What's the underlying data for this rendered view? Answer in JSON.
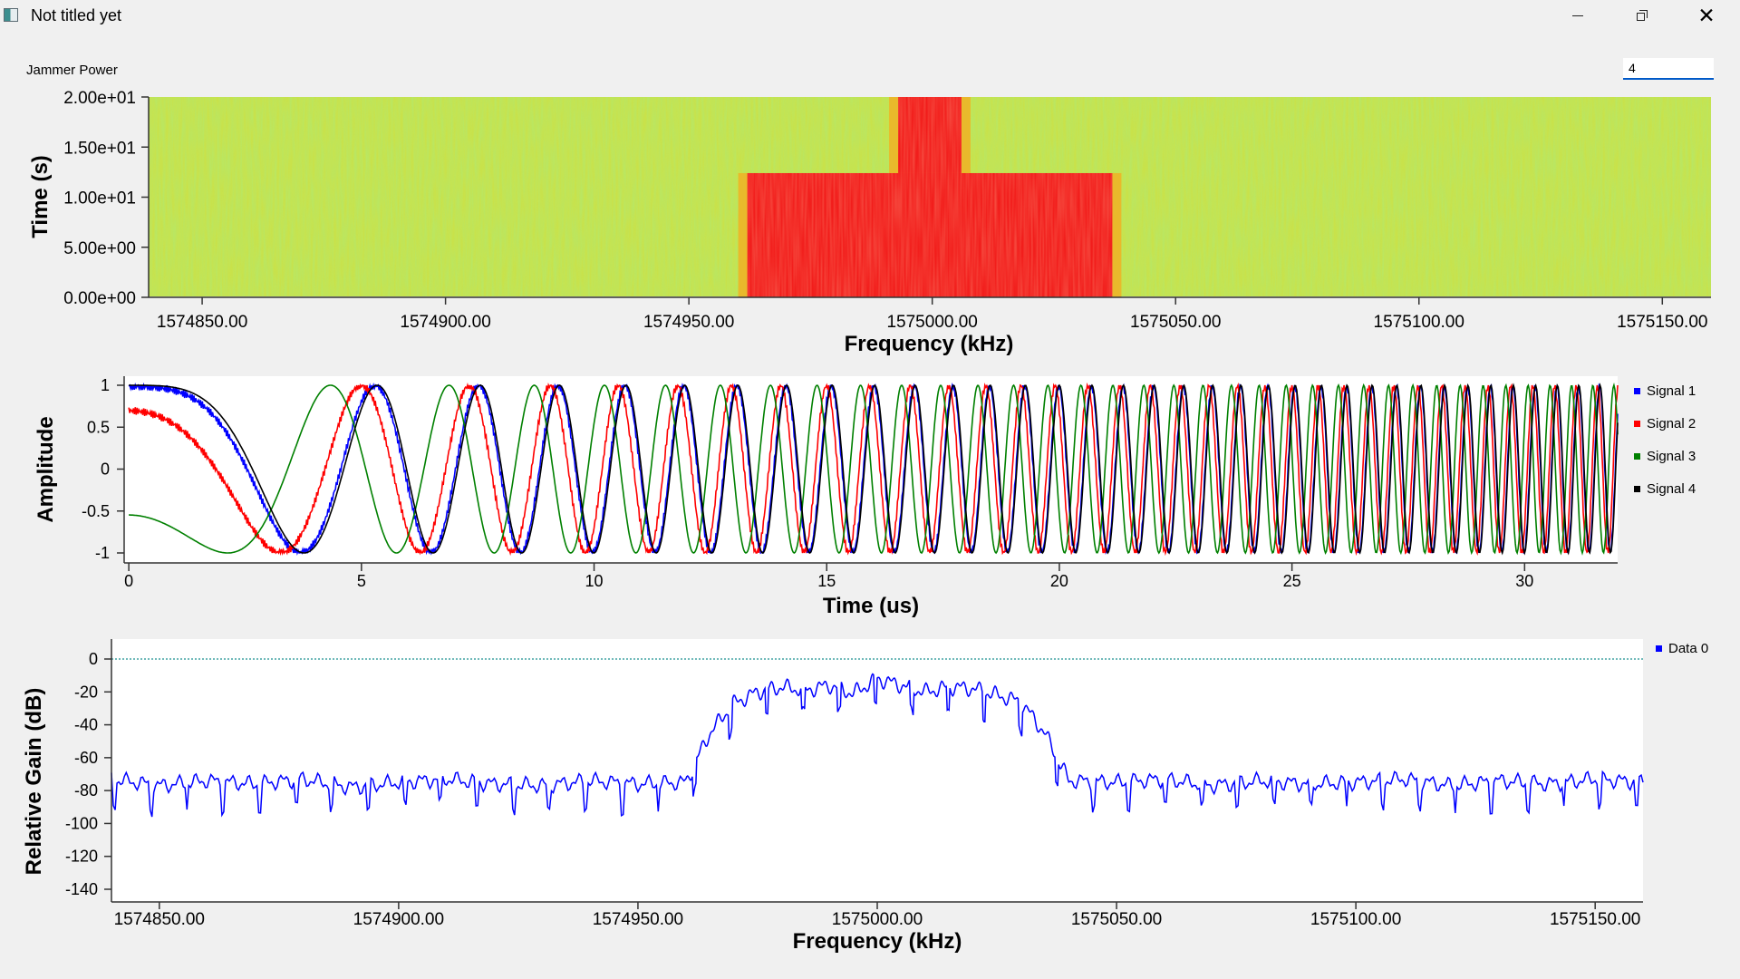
{
  "window": {
    "title": "Not titled yet",
    "controls": {
      "minimize": "minimize-icon",
      "maximize": "restore-icon",
      "close": "close-icon"
    }
  },
  "jammer_power": {
    "label": "Jammer Power",
    "value": "4"
  },
  "chart_data": [
    {
      "type": "heatmap",
      "xlabel": "Frequency (kHz)",
      "ylabel": "Time (s)",
      "x_ticks": [
        "1574850.00",
        "1574900.00",
        "1574950.00",
        "1575000.00",
        "1575050.00",
        "1575100.00",
        "1575150.00"
      ],
      "y_ticks": [
        "0.00e+00",
        "5.00e+00",
        "1.00e+01",
        "1.50e+01",
        "2.00e+01"
      ],
      "xlim": [
        1574839,
        1575160
      ],
      "ylim": [
        0,
        20
      ],
      "background": "noise floor",
      "features": [
        {
          "x": [
            1574962,
            1575037
          ],
          "y": [
            0,
            12.4
          ],
          "level": "high"
        },
        {
          "x": [
            1574993,
            1575006
          ],
          "y": [
            12.4,
            20
          ],
          "level": "high"
        }
      ]
    },
    {
      "type": "line",
      "xlabel": "Time (us)",
      "ylabel": "Amplitude",
      "x_ticks": [
        "0",
        "5",
        "10",
        "15",
        "20",
        "25",
        "30"
      ],
      "y_ticks": [
        "1",
        "0.5",
        "0",
        "-0.5",
        "-1"
      ],
      "xlim": [
        -0.1,
        32
      ],
      "ylim": [
        -1,
        1
      ],
      "legend": "right",
      "series": [
        {
          "name": "Signal 1",
          "color": "#0000ff"
        },
        {
          "name": "Signal 2",
          "color": "#ff0000"
        },
        {
          "name": "Signal 3",
          "color": "#008000"
        },
        {
          "name": "Signal 4",
          "color": "#000000"
        }
      ]
    },
    {
      "type": "line",
      "xlabel": "Frequency (kHz)",
      "ylabel": "Relative Gain (dB)",
      "x_ticks": [
        "1574850.00",
        "1574900.00",
        "1574950.00",
        "1575000.00",
        "1575050.00",
        "1575100.00",
        "1575150.00"
      ],
      "y_ticks": [
        "0",
        "-20",
        "-40",
        "-60",
        "-80",
        "-100",
        "-120",
        "-140"
      ],
      "xlim": [
        1574840,
        1575160
      ],
      "ylim": [
        -140,
        0
      ],
      "reference_line": 0,
      "legend": "right",
      "series": [
        {
          "name": "Data 0",
          "color": "#0000ff",
          "x": [
            1574840,
            1574850,
            1574860,
            1574870,
            1574880,
            1574890,
            1574900,
            1574910,
            1574920,
            1574930,
            1574940,
            1574950,
            1574960,
            1574965,
            1574970,
            1574975,
            1574980,
            1574985,
            1574990,
            1574995,
            1575000,
            1575005,
            1575010,
            1575015,
            1575020,
            1575025,
            1575030,
            1575035,
            1575040,
            1575050,
            1575060,
            1575070,
            1575080,
            1575090,
            1575100,
            1575110,
            1575120,
            1575130,
            1575140,
            1575150,
            1575160
          ],
          "values": [
            -73,
            -77,
            -74,
            -76,
            -73,
            -78,
            -75,
            -73,
            -76,
            -77,
            -74,
            -76,
            -75,
            -45,
            -27,
            -20,
            -17,
            -19,
            -16,
            -21,
            -12,
            -16,
            -20,
            -17,
            -18,
            -22,
            -26,
            -45,
            -74,
            -75,
            -73,
            -77,
            -74,
            -76,
            -75,
            -73,
            -77,
            -74,
            -76,
            -73,
            -75
          ]
        }
      ]
    }
  ]
}
